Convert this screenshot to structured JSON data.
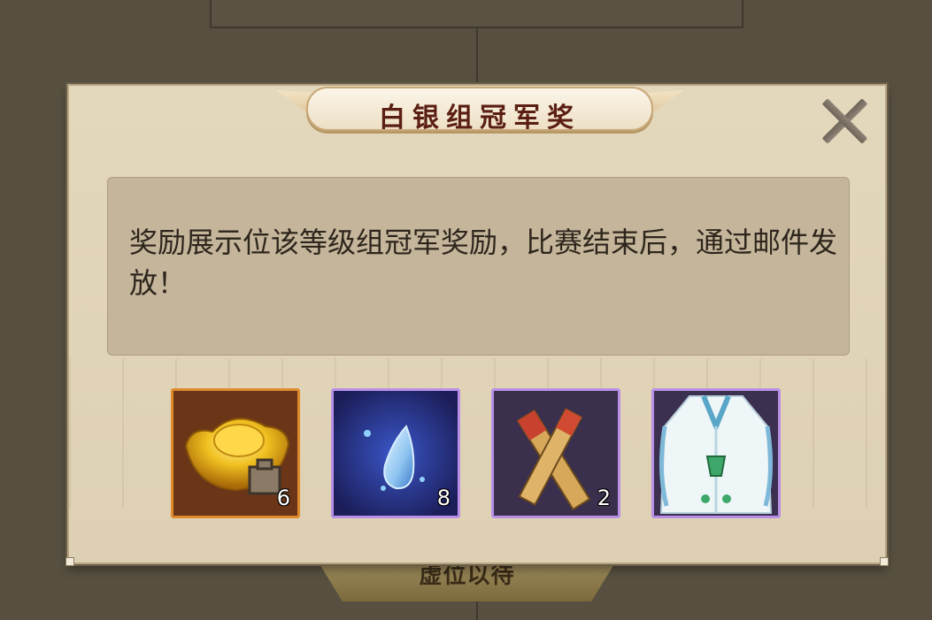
{
  "background": {
    "button_label": "虚位以待"
  },
  "modal": {
    "title": "白银组冠军奖",
    "close_icon": "close-icon",
    "description": "奖励展示位该等级组冠军奖励，比赛结束后，通过邮件发放！",
    "rewards": [
      {
        "icon": "gold-ingot-icon",
        "rarity": "orange",
        "count": "6"
      },
      {
        "icon": "water-drop-icon",
        "rarity": "purple",
        "count": "8"
      },
      {
        "icon": "brush-scroll-icon",
        "rarity": "purple",
        "count": "2"
      },
      {
        "icon": "robe-costume-icon",
        "rarity": "purple",
        "count": ""
      }
    ]
  },
  "colors": {
    "orange_frame": "#e08a2e",
    "purple_frame": "#b990e6",
    "title_text": "#5a1e12"
  }
}
